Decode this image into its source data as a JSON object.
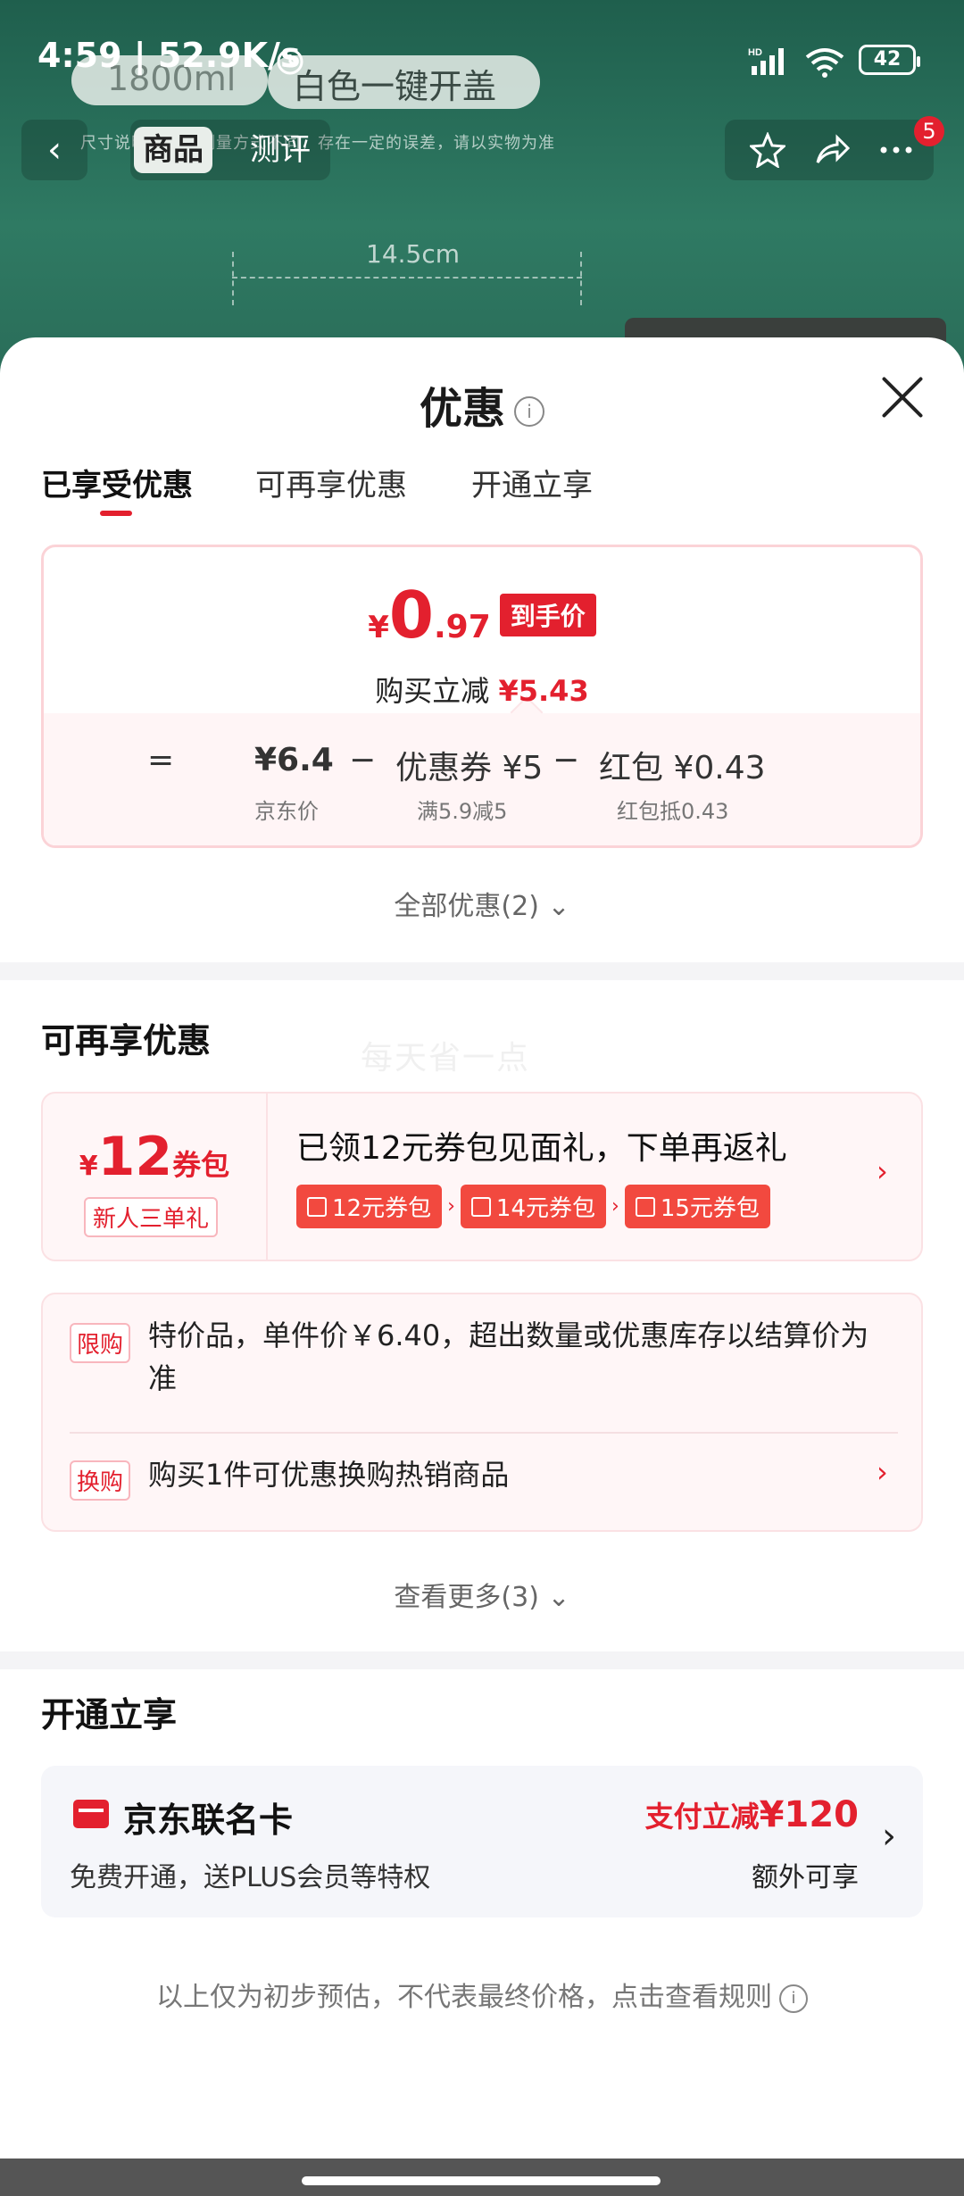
{
  "background": {
    "capacity": "1800ml",
    "label": "白色一键开盖",
    "note": "尺寸说明：由于测量方式不同，存在一定的误差，请以实物为准",
    "dimension": "14.5cm"
  },
  "status": {
    "time": "4:59 | 52.9K/s",
    "battery": "42",
    "icons": [
      "alarm-icon",
      "hd-signal-icon",
      "wifi-icon",
      "battery-icon"
    ]
  },
  "nav": {
    "back_icon": "back-arrow-icon",
    "tab_goods": "商品",
    "tab_review": "测评",
    "actions": [
      "favorite-star-icon",
      "share-icon",
      "more-icon"
    ],
    "badge": "5"
  },
  "sheet": {
    "title": "优惠",
    "tabs": [
      "已享受优惠",
      "可再享优惠",
      "开通立享"
    ],
    "price": {
      "yen": "¥",
      "int": "0",
      "dec": ".97",
      "tag": "到手价",
      "sub_label": "购买立减",
      "sub_amount": "¥5.43",
      "eq_sign": "=",
      "minus": "−",
      "jd_price": "¥6.4",
      "jd_label": "京东价",
      "coupon": "优惠券 ¥5",
      "coupon_label": "满5.9减5",
      "redpack": "红包 ¥0.43",
      "redpack_label": "红包抵0.43"
    },
    "all_promos": "全部优惠(2)",
    "section2_title": "可再享优惠",
    "watermark": "每天省一点",
    "couponpack": {
      "yen": "¥",
      "amount": "12",
      "unit": "券包",
      "tag": "新人三单礼",
      "title": "已领12元券包见面礼，下单再返礼",
      "chips": [
        "12元券包",
        "14元券包",
        "15元券包"
      ]
    },
    "rules": [
      {
        "badge": "限购",
        "text": "特价品，单件价￥6.40，超出数量或优惠库存以结算价为准"
      },
      {
        "badge": "换购",
        "text": "购买1件可优惠换购热销商品"
      }
    ],
    "view_more": "查看更多(3)",
    "section3_title": "开通立享",
    "card": {
      "name": "京东联名卡",
      "desc": "免费开通，送PLUS会员等特权",
      "promo_prefix": "支付立减",
      "promo_amount": "¥120",
      "extra": "额外可享"
    },
    "disclaimer": "以上仅为初步预估，不代表最终价格，点击查看规则"
  },
  "colors": {
    "accent": "#e3202e",
    "bg_green": "#2f7a63"
  }
}
